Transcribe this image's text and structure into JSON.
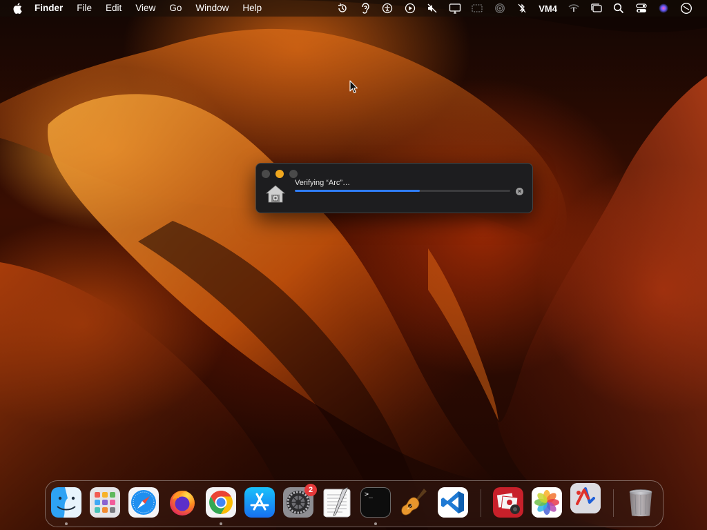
{
  "menubar": {
    "app_name": "Finder",
    "menus": [
      "File",
      "Edit",
      "View",
      "Go",
      "Window",
      "Help"
    ],
    "status_icons": [
      "time-machine-icon",
      "hearing-icon",
      "accessibility-icon",
      "screen-record-icon",
      "muted-speaker-icon",
      "display-icon",
      "screen-mirroring-icon",
      "airdrop-icon",
      "no-bluetooth-icon",
      "wifi-icon",
      "stage-manager-icon",
      "search-icon",
      "control-center-icon",
      "siri-icon",
      "clock-icon"
    ],
    "vm_label": "VM4"
  },
  "verify_dialog": {
    "title": "Verifying “Arc”…",
    "progress_percent": 58,
    "stop_glyph": "×"
  },
  "dock": {
    "apps": [
      "Finder",
      "Launchpad",
      "Safari",
      "Firefox",
      "Google Chrome",
      "App Store",
      "System Settings",
      "TextEdit",
      "Terminal",
      "GarageBand",
      "Visual Studio Code",
      "Photo Booth",
      "Photos",
      "Instruments",
      "Trash"
    ],
    "settings_badge": "2",
    "terminal_prompt": ">_"
  },
  "colors": {
    "accent": "#2f7df6",
    "minimize": "#f0a71e",
    "badge": "#e6393a"
  }
}
